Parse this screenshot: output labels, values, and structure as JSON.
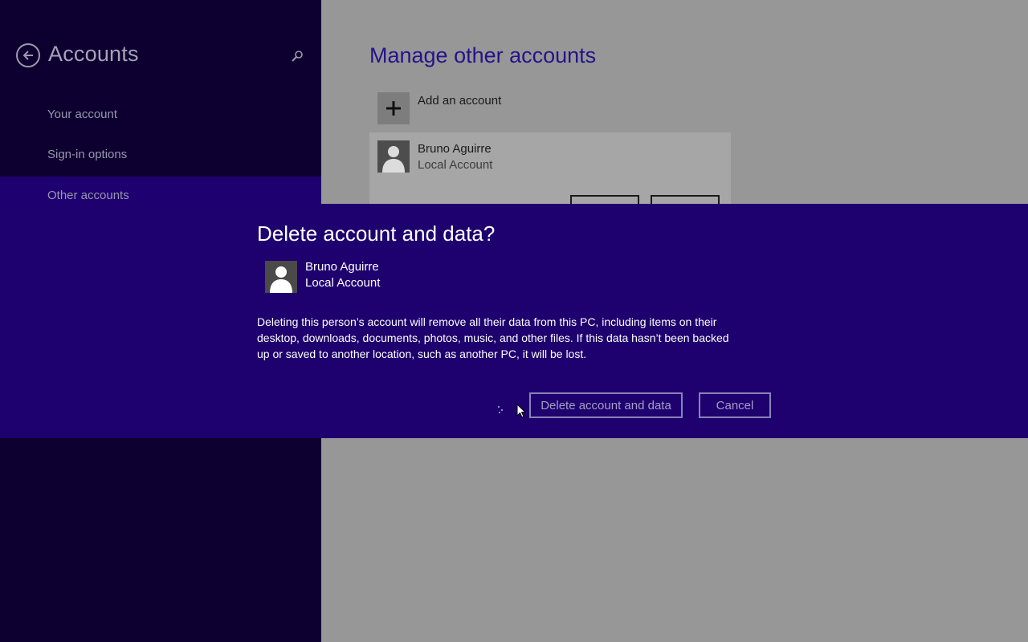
{
  "sidebar": {
    "title": "Accounts",
    "items": [
      {
        "label": "Your account",
        "selected": false
      },
      {
        "label": "Sign-in options",
        "selected": false
      },
      {
        "label": "Other accounts",
        "selected": true
      }
    ]
  },
  "content": {
    "title": "Manage other accounts",
    "add_account_label": "Add an account",
    "account": {
      "name": "Bruno Aguirre",
      "type": "Local Account"
    }
  },
  "dialog": {
    "title": "Delete account and data?",
    "account_name": "Bruno Aguirre",
    "account_type": "Local Account",
    "message": "Deleting this person’s account will remove all their data from this PC, including items on their desktop, downloads, documents, photos, music, and other files. If this data hasn’t been backed up or saved to another location, such as another PC, it will be lost.",
    "delete_label": "Delete account and data",
    "cancel_label": "Cancel"
  },
  "icons": {
    "back": "back-arrow-icon",
    "search": "search-icon",
    "add": "plus-icon",
    "avatar": "user-silhouette-icon",
    "spinner": "progress-dots-icon",
    "cursor": "mouse-pointer-icon"
  },
  "colors": {
    "sidebar_bg": "#0d0030",
    "sidebar_selected": "#1e0070",
    "dialog_bg": "#1e006e",
    "content_bg": "#979797",
    "accent_title": "#25138a"
  }
}
